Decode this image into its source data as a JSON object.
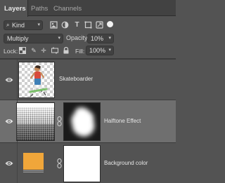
{
  "tabs": [
    {
      "label": "Layers",
      "active": true
    },
    {
      "label": "Paths",
      "active": false
    },
    {
      "label": "Channels",
      "active": false
    }
  ],
  "filter": {
    "kind_label": "Kind",
    "icons": [
      "pixel-layer-filter-icon",
      "adjustment-layer-filter-icon",
      "type-layer-filter-icon",
      "shape-layer-filter-icon",
      "smart-object-filter-icon",
      "filter-toggle"
    ]
  },
  "blend": {
    "mode": "Multiply",
    "opacity_label": "Opacity:",
    "opacity_value": "10%"
  },
  "lock": {
    "label": "Lock:",
    "icons": [
      "lock-transparent-pixels-icon",
      "lock-image-pixels-icon",
      "lock-position-icon",
      "prevent-auto-nesting-icon",
      "lock-all-icon"
    ],
    "fill_label": "Fill:",
    "fill_value": "100%"
  },
  "layers": [
    {
      "name": "Skateboarder",
      "visible": true,
      "selected": false
    },
    {
      "name": "Halftone Effect",
      "visible": true,
      "selected": true
    },
    {
      "name": "Background color",
      "visible": true,
      "selected": false
    }
  ],
  "colors": {
    "panel_bg": "#535353",
    "tab_bar_bg": "#424242",
    "selected_layer_bg": "#6f6f6f",
    "background_fill": "#f0a63a"
  }
}
